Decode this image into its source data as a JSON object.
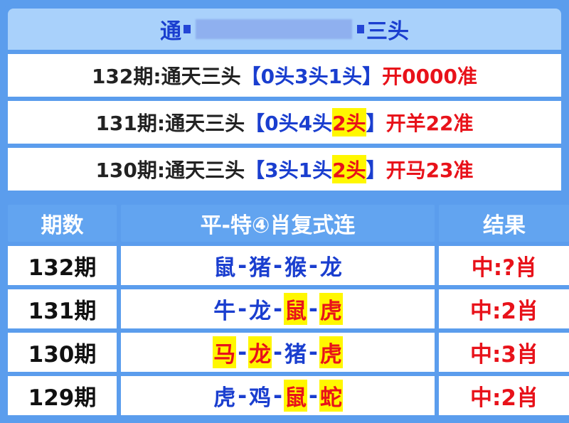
{
  "header": {
    "title_left": "通",
    "title_right": "三头"
  },
  "top_rows": [
    {
      "period": "132期",
      "name": ":通天三头",
      "lb": "【",
      "parts": [
        {
          "text": "0头",
          "hl": false
        },
        {
          "text": "3头",
          "hl": false
        },
        {
          "text": "1头",
          "hl": false
        }
      ],
      "rb": "】",
      "open_result": "开0000准"
    },
    {
      "period": "131期",
      "name": ":通天三头",
      "lb": "【",
      "parts": [
        {
          "text": "0头",
          "hl": false
        },
        {
          "text": "4头",
          "hl": false
        },
        {
          "text": "2头",
          "hl": true
        }
      ],
      "rb": "】",
      "open_result": "开羊22准"
    },
    {
      "period": "130期",
      "name": ":通天三头",
      "lb": "【",
      "parts": [
        {
          "text": "3头",
          "hl": false
        },
        {
          "text": "1头",
          "hl": false
        },
        {
          "text": "2头",
          "hl": true
        }
      ],
      "rb": "】",
      "open_result": "开马23准"
    }
  ],
  "table": {
    "headers": [
      "期数",
      "平-特④肖复式连",
      "结果"
    ],
    "separator": "-",
    "rows": [
      {
        "period": "132期",
        "zodiacs": [
          {
            "text": "鼠",
            "hit": false
          },
          {
            "text": "猪",
            "hit": false
          },
          {
            "text": "猴",
            "hit": false
          },
          {
            "text": "龙",
            "hit": false
          }
        ],
        "result": "中:?肖"
      },
      {
        "period": "131期",
        "zodiacs": [
          {
            "text": "牛",
            "hit": false
          },
          {
            "text": "龙",
            "hit": false
          },
          {
            "text": "鼠",
            "hit": true
          },
          {
            "text": "虎",
            "hit": true
          }
        ],
        "result": "中:2肖"
      },
      {
        "period": "130期",
        "zodiacs": [
          {
            "text": "马",
            "hit": true
          },
          {
            "text": "龙",
            "hit": true
          },
          {
            "text": "猪",
            "hit": false
          },
          {
            "text": "虎",
            "hit": true
          }
        ],
        "result": "中:3肖"
      },
      {
        "period": "129期",
        "zodiacs": [
          {
            "text": "虎",
            "hit": false
          },
          {
            "text": "鸡",
            "hit": false
          },
          {
            "text": "鼠",
            "hit": true
          },
          {
            "text": "蛇",
            "hit": true
          }
        ],
        "result": "中:2肖"
      }
    ]
  },
  "colors": {
    "background": "#5b9ded",
    "header_bar": "#a9d1fb",
    "blue_text": "#1a3ecf",
    "red_text": "#e8121a",
    "highlight": "#fff700"
  }
}
